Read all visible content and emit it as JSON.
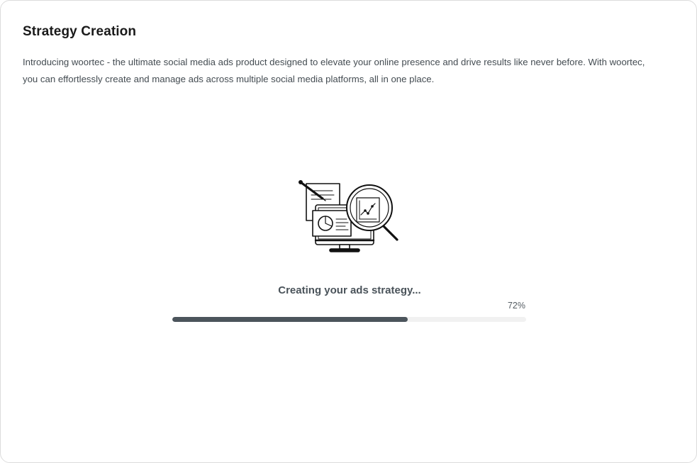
{
  "header": {
    "title": "Strategy Creation",
    "description": "Introducing woortec - the ultimate social media ads product designed to elevate your online presence and drive results like never before. With woortec, you can effortlessly create and manage ads across multiple social media platforms, all in one place."
  },
  "loader": {
    "illustration_icon": "monitor-analytics-magnifier-icon",
    "status_text": "Creating your ads strategy...",
    "progress_label": "72%",
    "progress": 0.665
  },
  "colors": {
    "progress_fill": "#4c555c",
    "progress_track": "#f1f1f1",
    "title": "#1a1a1a",
    "text": "#444c52"
  }
}
